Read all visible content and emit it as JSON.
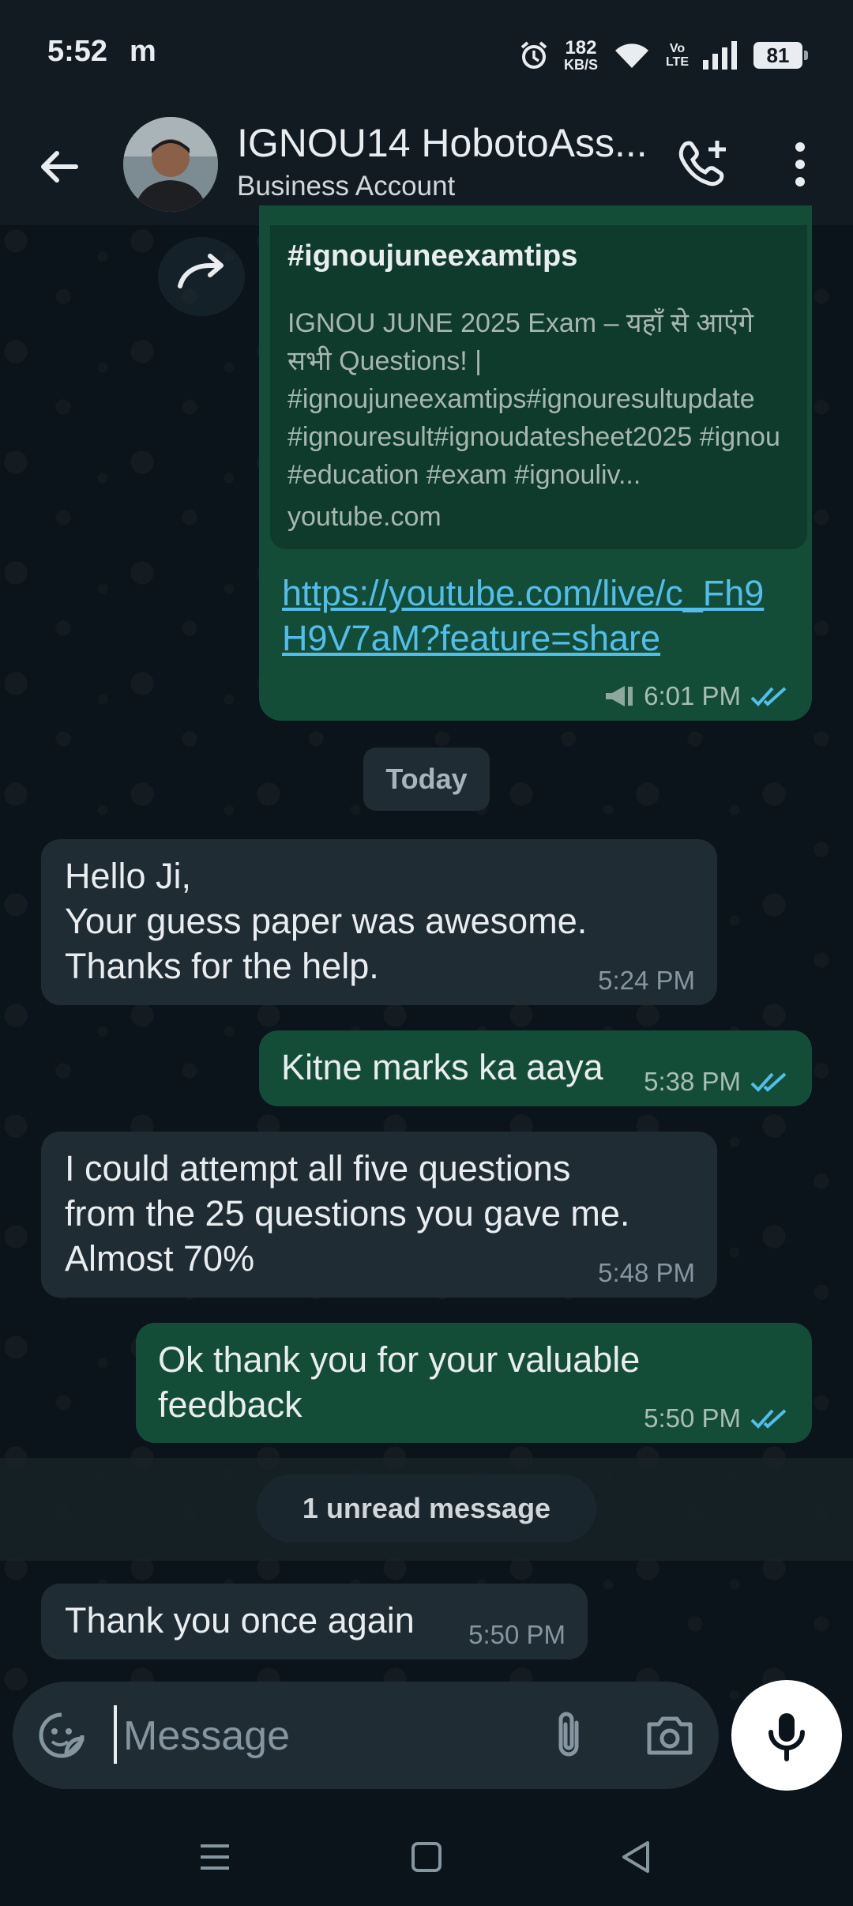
{
  "status_bar": {
    "time": "5:52",
    "carrier_icon": "m",
    "speed_top": "182",
    "speed_bottom": "KB/S",
    "volte_top": "Vo",
    "volte_bottom": "LTE",
    "battery": "81"
  },
  "header": {
    "contact_name": "IGNOU14 HobotoAss...",
    "subtitle": "Business Account"
  },
  "messages": {
    "forwarded": {
      "preview_title": "#ignoujuneexamtips",
      "preview_description": "IGNOU JUNE 2025 Exam – यहाँ से आएंगे सभी Questions! | #ignoujuneexamtips#ignouresultupdate #ignouresult#ignoudatesheet2025 #ignou #education #exam #ignouliv...",
      "preview_domain": "youtube.com",
      "link": "https://youtube.com/live/c_Fh9H9V7aM?feature=share",
      "time": "6:01 PM"
    },
    "date_divider": "Today",
    "m1": {
      "text": "Hello Ji,\nYour guess paper was awesome.\nThanks for the help.",
      "time": "5:24 PM"
    },
    "m2": {
      "text": "Kitne marks ka aaya",
      "time": "5:38 PM"
    },
    "m3": {
      "text": "I could attempt all five questions\nfrom the 25 questions you gave me.\nAlmost 70%",
      "time": "5:48 PM"
    },
    "m4": {
      "text": "Ok thank you for your valuable\nfeedback",
      "time": "5:50 PM"
    },
    "unread": "1 unread message",
    "m5": {
      "text": "Thank you once again",
      "time": "5:50 PM"
    }
  },
  "composer": {
    "placeholder": "Message"
  },
  "colors": {
    "outgoing": "#144d37",
    "incoming": "#1f2c34",
    "link": "#53bdeb",
    "read_ticks": "#53bdeb",
    "background": "#0b141a"
  }
}
